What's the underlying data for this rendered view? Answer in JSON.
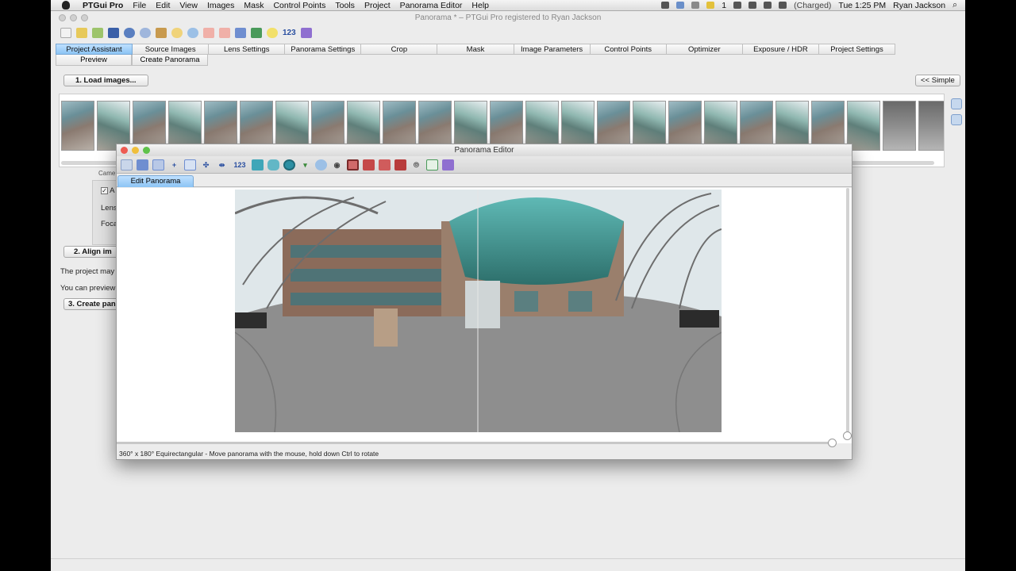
{
  "menubar": {
    "app_name": "PTGui Pro",
    "menus": [
      "File",
      "Edit",
      "View",
      "Images",
      "Mask",
      "Control Points",
      "Tools",
      "Project",
      "Panorama Editor",
      "Help"
    ],
    "battery_text": "(Charged)",
    "clock": "Tue 1:25 PM",
    "user": "Ryan Jackson",
    "badge": "1"
  },
  "window": {
    "title": "Panorama * – PTGui Pro registered to Ryan Jackson",
    "toolbar_numeric_label": "123"
  },
  "tabs": [
    "Project Assistant",
    "Source Images",
    "Lens Settings",
    "Panorama Settings",
    "Crop",
    "Mask",
    "Image Parameters",
    "Control Points",
    "Optimizer",
    "Exposure / HDR",
    "Project Settings"
  ],
  "subtabs": [
    "Preview",
    "Create Panorama"
  ],
  "assistant": {
    "load_button": "1. Load images...",
    "simple_button": "<< Simple",
    "camera_label": "Came",
    "auto_label": "A",
    "lens_label": "Lens",
    "focal_label": "Foca",
    "align_button": "2. Align im",
    "project_text": "The project may",
    "preview_text": "You can preview",
    "create_button": "3. Create pan"
  },
  "panorama_editor": {
    "title": "Panorama Editor",
    "toolbar_numeric_label": "123",
    "tab_label": "Edit Panorama",
    "status": "360° x 180° Equirectangular - Move panorama with the mouse, hold down Ctrl to rotate",
    "projection_h": "360°",
    "projection_v": "180°"
  },
  "filmstrip": {
    "image_count": 25
  },
  "colors": {
    "active_tab": "#8cc4f4",
    "toolbar_icon": "#2a4fa0",
    "window_bg": "#ececec"
  }
}
